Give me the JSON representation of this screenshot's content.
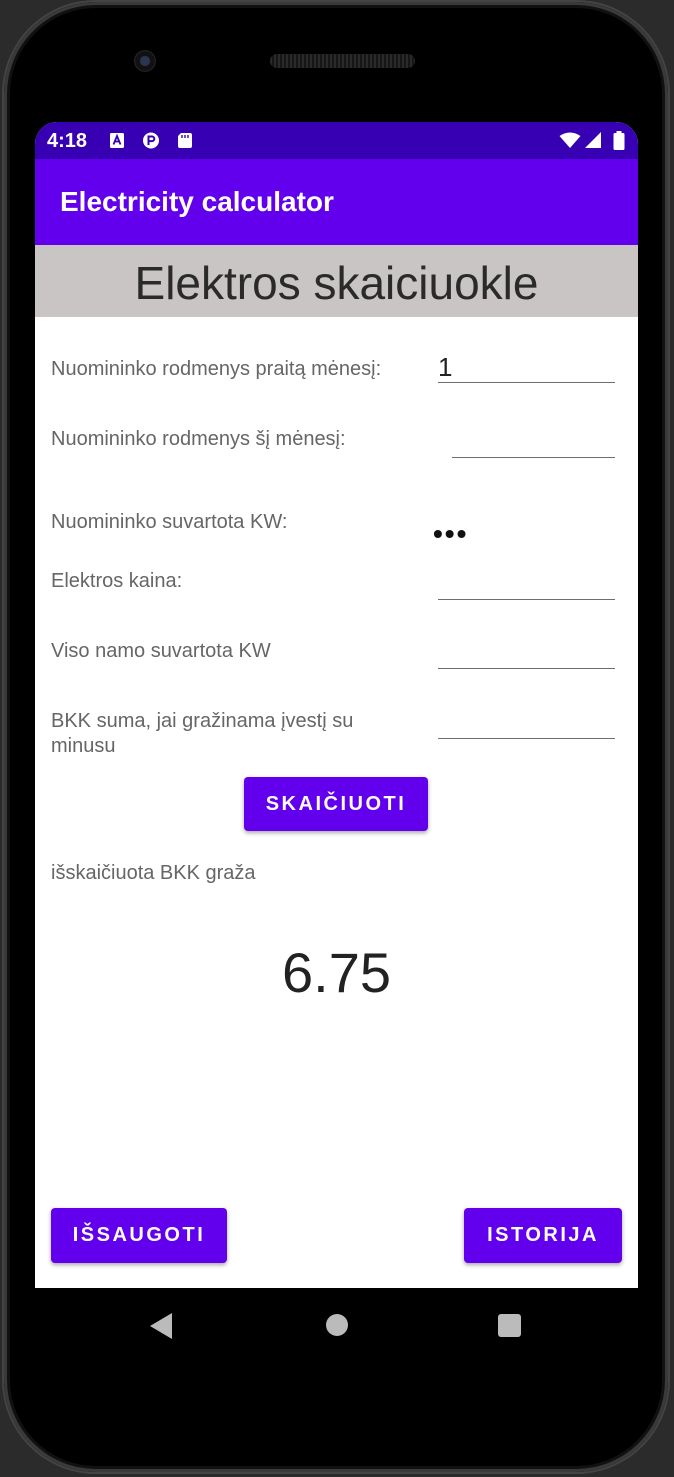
{
  "status_bar": {
    "time": "4:18",
    "left_icons": [
      "a-notification-icon",
      "p-notification-icon",
      "sd-card-icon"
    ],
    "right_icons": [
      "wifi-icon",
      "signal-icon",
      "battery-icon"
    ]
  },
  "app_bar": {
    "title": "Electricity calculator"
  },
  "header": {
    "title": "Elektros skaiciuokle"
  },
  "form": {
    "prev_reading_label": "Nuomininko rodmenys praitą mėnesį:",
    "prev_reading_value": "1",
    "curr_reading_label": "Nuomininko rodmenys šį mėnesį:",
    "curr_reading_value": "",
    "consumed_label": "Nuomininko suvartota KW:",
    "consumed_value": "•••",
    "price_label": "Elektros kaina:",
    "price_value": "",
    "house_total_label": "Viso namo suvartota KW",
    "house_total_value": "",
    "bkk_label": "BKK suma, jai gražinama įvestį su minusu",
    "bkk_value": ""
  },
  "actions": {
    "calculate_label": "SKAIČIUOTI",
    "save_label": "IŠSAUGOTI",
    "history_label": "ISTORIJA"
  },
  "result": {
    "label": "išskaičiuota BKK graža",
    "value": "6.75"
  },
  "colors": {
    "status_bar": "#3700b3",
    "primary": "#6200ee",
    "header_bg": "#c8c5c4"
  }
}
